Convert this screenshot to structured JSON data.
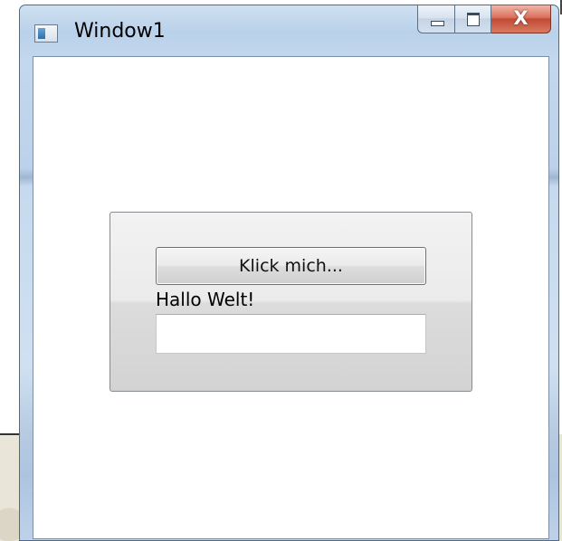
{
  "window": {
    "title": "Window1",
    "close_symbol": "X"
  },
  "panel": {
    "button_label": "Klick mich...",
    "label_text": "Hallo Welt!",
    "input_value": ""
  }
}
